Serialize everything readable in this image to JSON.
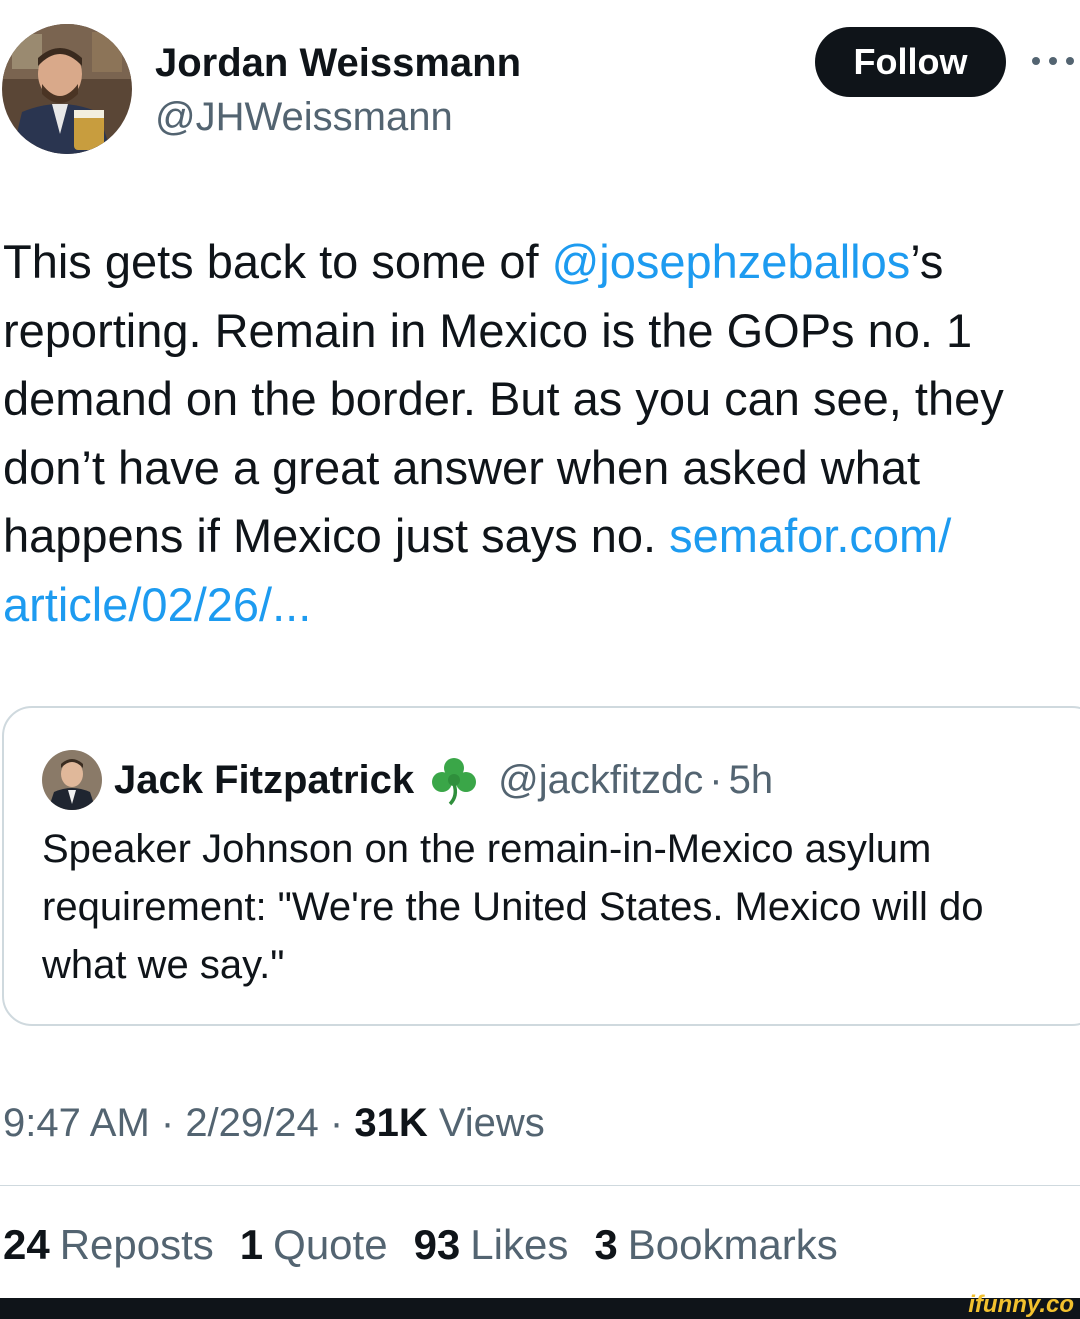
{
  "author": {
    "name": "Jordan Weissmann",
    "handle": "@JHWeissmann",
    "avatar_icon": "profile-photo"
  },
  "header": {
    "follow_label": "Follow",
    "more_icon": "more-horizontal-icon"
  },
  "tweet": {
    "text_part1": "This gets back to some of ",
    "mention": "@josephzeballos",
    "text_part2": "’s reporting. Remain in Mexico is the GOPs no. 1 demand on the border. But as you can see, they don’t have a great answer when asked what happens if Mexico just says no. ",
    "link_line1": "semafor.com/",
    "link_line2": "article/02/26/..."
  },
  "quote": {
    "name": "Jack Fitzpatrick",
    "emoji_icon": "shamrock-icon",
    "handle": "@jackfitzdc",
    "separator": "·",
    "time": "5h",
    "text": "Speaker Johnson on the remain-in-Mexico asylum requirement: \"We're the United States. Mexico will do what we say.\""
  },
  "meta": {
    "time": "9:47 AM",
    "sep1": " · ",
    "date": "2/29/24",
    "sep2": " · ",
    "views_count": "31K",
    "views_label": " Views"
  },
  "stats": {
    "reposts_count": "24",
    "reposts_label": "Reposts",
    "quotes_count": "1",
    "quotes_label": "Quote",
    "likes_count": "93",
    "likes_label": "Likes",
    "bookmarks_count": "3",
    "bookmarks_label": "Bookmarks"
  },
  "watermark": "ifunny.co",
  "colors": {
    "link": "#1d9bf0",
    "text": "#0f1419",
    "secondary": "#536471",
    "border": "#cfd9de",
    "follow_bg": "#0f1419"
  }
}
